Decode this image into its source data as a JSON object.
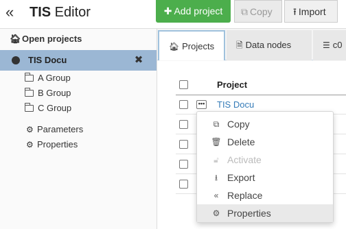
{
  "header": {
    "collapse_glyph": "«",
    "app_title_bold": "TIS",
    "app_title_rest": " Editor",
    "add_project_label": "Add project",
    "copy_label": "Copy",
    "import_label": "Import"
  },
  "sidebar": {
    "heading": "Open projects",
    "project": {
      "name": "TIS Docu",
      "close_glyph": "✖"
    },
    "groups": [
      "A Group",
      "B Group",
      "C Group"
    ],
    "links": [
      "Parameters",
      "Properties"
    ]
  },
  "tabs": [
    {
      "label": "Projects",
      "icon": "home-icon"
    },
    {
      "label": "Data nodes",
      "icon": "document-icon"
    },
    {
      "label": "c0",
      "icon": "list-icon"
    }
  ],
  "table": {
    "column_header": "Project",
    "rows": [
      {
        "name": "TIS Docu"
      },
      {
        "name": ""
      },
      {
        "name": ""
      },
      {
        "name": ""
      },
      {
        "name": ""
      }
    ]
  },
  "context_menu": {
    "items": [
      {
        "label": "Copy",
        "icon": "copy-icon",
        "enabled": true
      },
      {
        "label": "Delete",
        "icon": "trash-icon",
        "enabled": true
      },
      {
        "label": "Activate",
        "icon": "unlock-icon",
        "enabled": false
      },
      {
        "label": "Export",
        "icon": "download-icon",
        "enabled": true
      },
      {
        "label": "Replace",
        "icon": "double-left-icon",
        "enabled": true
      },
      {
        "label": "Properties",
        "icon": "gears-icon",
        "enabled": true,
        "highlighted": true
      }
    ]
  },
  "colors": {
    "add_button": "#4cae4c",
    "selected_project": "#9bb7d4",
    "link": "#337ab7",
    "active_tab_border": "#9fc1dd"
  }
}
